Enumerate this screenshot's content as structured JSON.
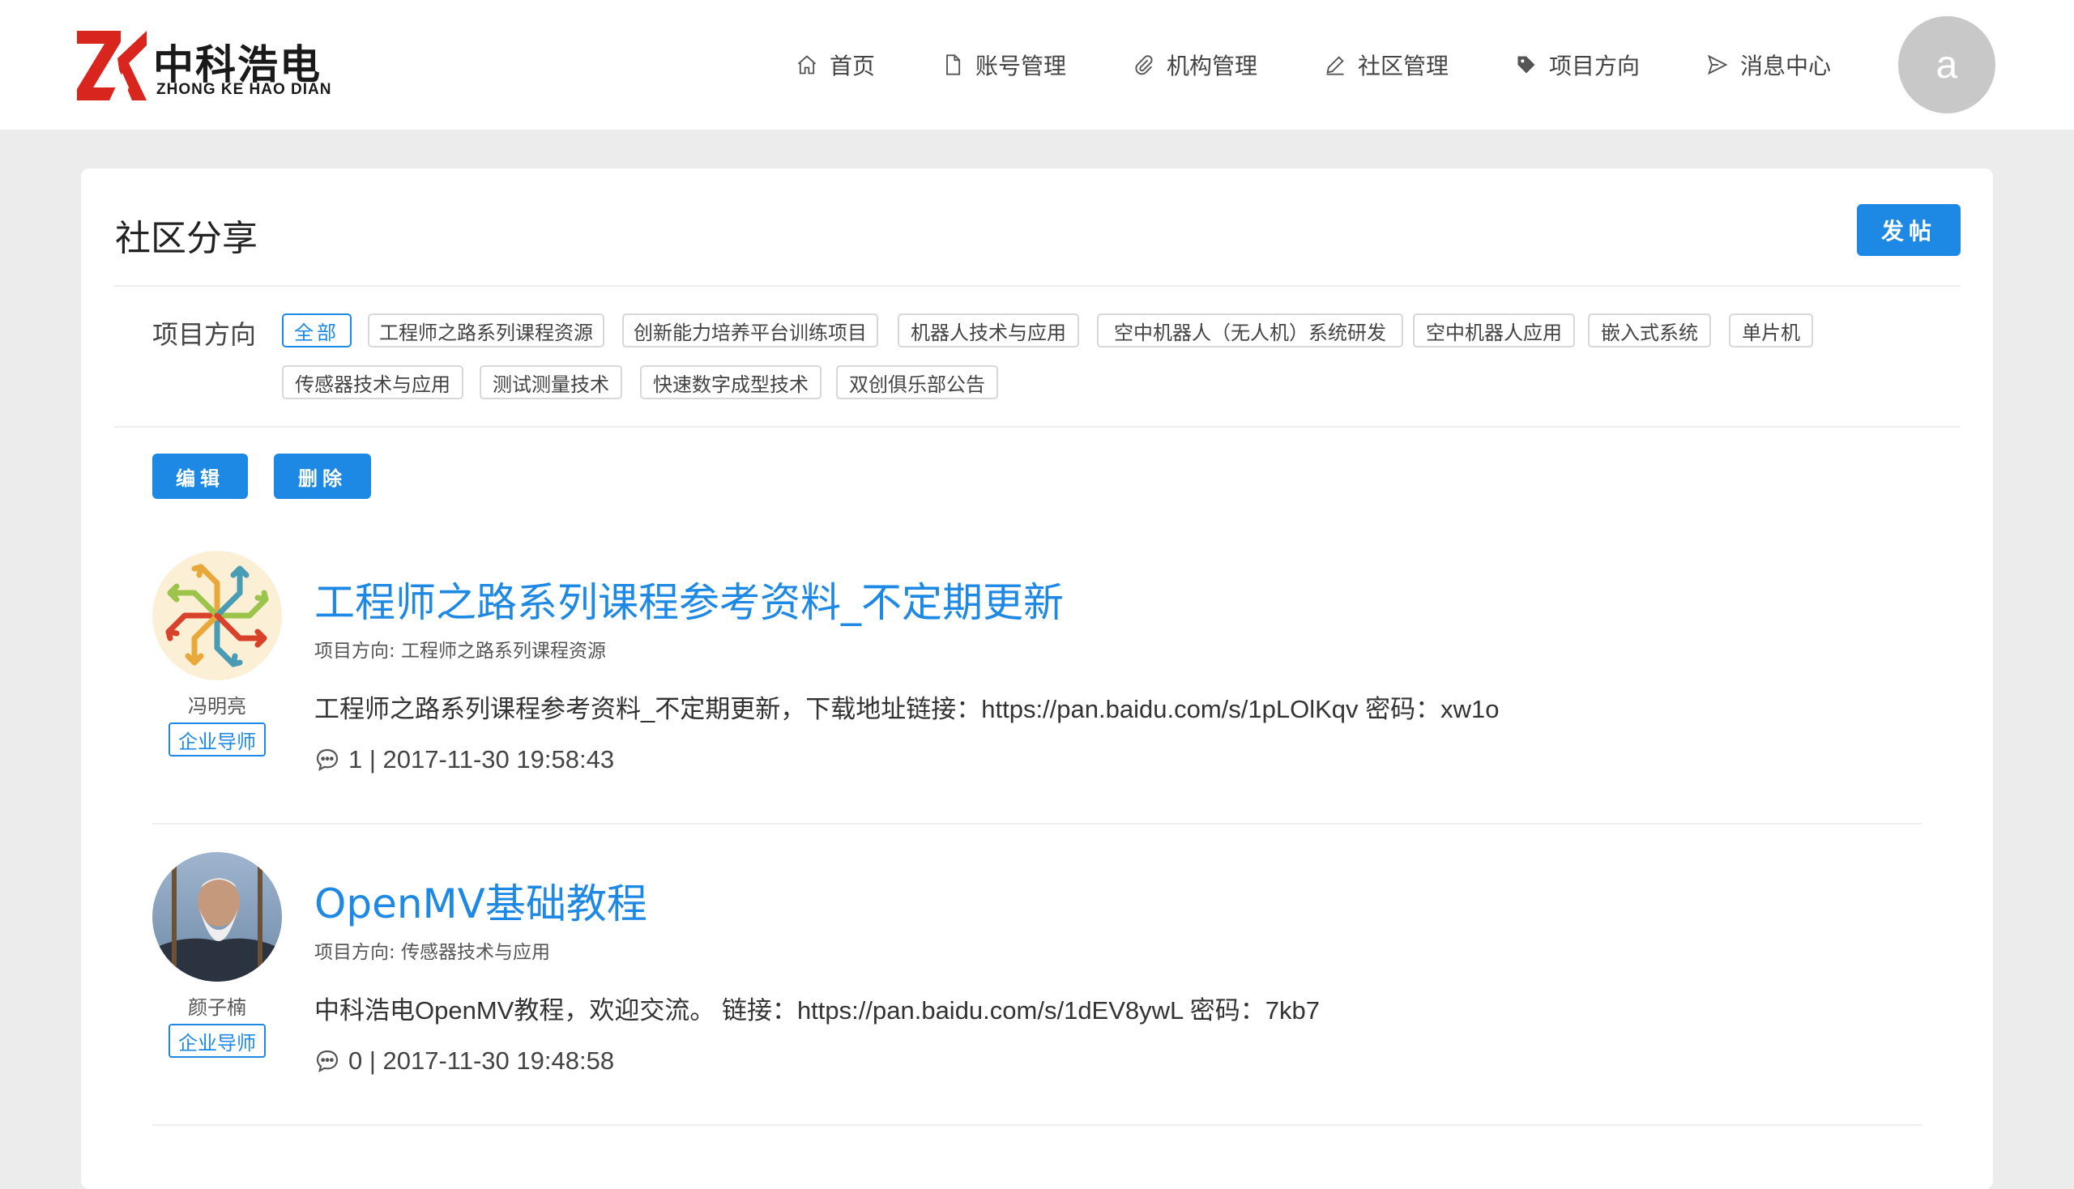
{
  "brand": {
    "name_cn": "中科浩电",
    "name_en": "ZHONG KE HAO DIAN",
    "colors": {
      "red": "#d8261f",
      "black": "#1a1a1a"
    }
  },
  "nav": {
    "items": [
      {
        "label": "首页",
        "icon": "home-icon"
      },
      {
        "label": "账号管理",
        "icon": "file-icon"
      },
      {
        "label": "机构管理",
        "icon": "paperclip-icon"
      },
      {
        "label": "社区管理",
        "icon": "pencil-icon"
      },
      {
        "label": "项目方向",
        "icon": "tag-icon"
      },
      {
        "label": "消息中心",
        "icon": "send-icon"
      }
    ],
    "user_initial": "a"
  },
  "page": {
    "title": "社区分享",
    "post_button": "发帖"
  },
  "filter": {
    "label": "项目方向",
    "tags": [
      {
        "label": "全部",
        "active": true
      },
      {
        "label": "工程师之路系列课程资源"
      },
      {
        "label": "创新能力培养平台训练项目"
      },
      {
        "label": "机器人技术与应用"
      },
      {
        "label": "空中机器人（无人机）系统研发"
      },
      {
        "label": "空中机器人应用"
      },
      {
        "label": "嵌入式系统"
      },
      {
        "label": "单片机"
      },
      {
        "label": "传感器技术与应用"
      },
      {
        "label": "测试测量技术"
      },
      {
        "label": "快速数字成型技术"
      },
      {
        "label": "双创俱乐部公告"
      }
    ]
  },
  "actions": {
    "edit": "编辑",
    "delete": "删除"
  },
  "posts": [
    {
      "author": "冯明亮",
      "role": "企业导师",
      "title": "工程师之路系列课程参考资料_不定期更新",
      "direction": "项目方向: 工程师之路系列课程资源",
      "body": "工程师之路系列课程参考资料_不定期更新，下载地址链接：https://pan.baidu.com/s/1pLOlKqv 密码：xw1o",
      "meta": "1 | 2017-11-30 19:58:43"
    },
    {
      "author": "颜子楠",
      "role": "企业导师",
      "title": "OpenMV基础教程",
      "direction": "项目方向: 传感器技术与应用",
      "body": "中科浩电OpenMV教程，欢迎交流。 链接：https://pan.baidu.com/s/1dEV8ywL 密码：7kb7",
      "meta": "0 | 2017-11-30 19:48:58"
    }
  ],
  "theme": {
    "accent": "#1e88e5",
    "background": "#ececec",
    "card": "#ffffff"
  }
}
